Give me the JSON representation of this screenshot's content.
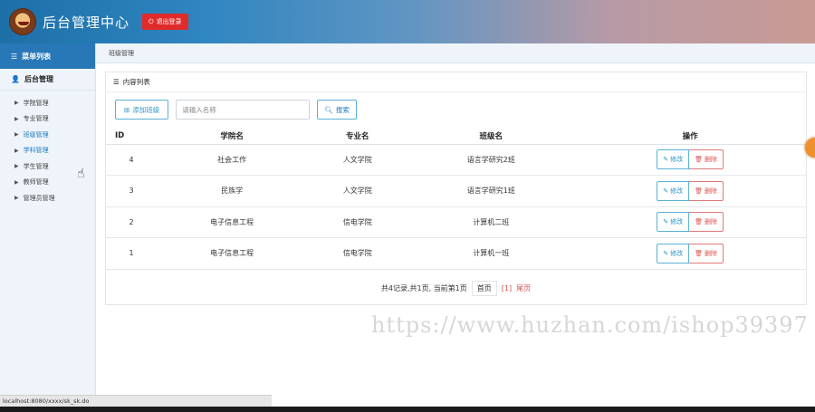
{
  "header": {
    "title": "后台管理中心",
    "logout_label": "退出登录"
  },
  "sidebar": {
    "menu_title": "菜单列表",
    "group_title": "后台管理",
    "items": [
      {
        "label": "学院管理"
      },
      {
        "label": "专业管理"
      },
      {
        "label": "班级管理"
      },
      {
        "label": "学科管理"
      },
      {
        "label": "学生管理"
      },
      {
        "label": "教师管理"
      },
      {
        "label": "管理员管理"
      }
    ]
  },
  "breadcrumb": "班级管理",
  "panel": {
    "title": "内容列表",
    "add_label": "添加班级",
    "search_placeholder": "请输入名称",
    "search_label": "搜索"
  },
  "table": {
    "headers": [
      "ID",
      "学院名",
      "专业名",
      "班级名",
      "操作"
    ],
    "rows": [
      {
        "id": "4",
        "college": "社会工作",
        "major": "人文学院",
        "class": "语言学研究2班"
      },
      {
        "id": "3",
        "college": "民族学",
        "major": "人文学院",
        "class": "语言学研究1班"
      },
      {
        "id": "2",
        "college": "电子信息工程",
        "major": "信电学院",
        "class": "计算机二班"
      },
      {
        "id": "1",
        "college": "电子信息工程",
        "major": "信电学院",
        "class": "计算机一班"
      }
    ],
    "edit_label": "修改",
    "delete_label": "删除"
  },
  "pager": {
    "summary": "共4记录,共1页, 当前第1页",
    "first_label": "首页",
    "page_link": "[1]",
    "last_label": "尾页"
  },
  "watermark": "https://www.huzhan.com/ishop39397",
  "status_url": "localhost:8080/xxxx/sk_sk.do",
  "colors": {
    "accent": "#2878b8",
    "danger": "#e02b2b",
    "sidebar_bg": "#eef4f9"
  }
}
